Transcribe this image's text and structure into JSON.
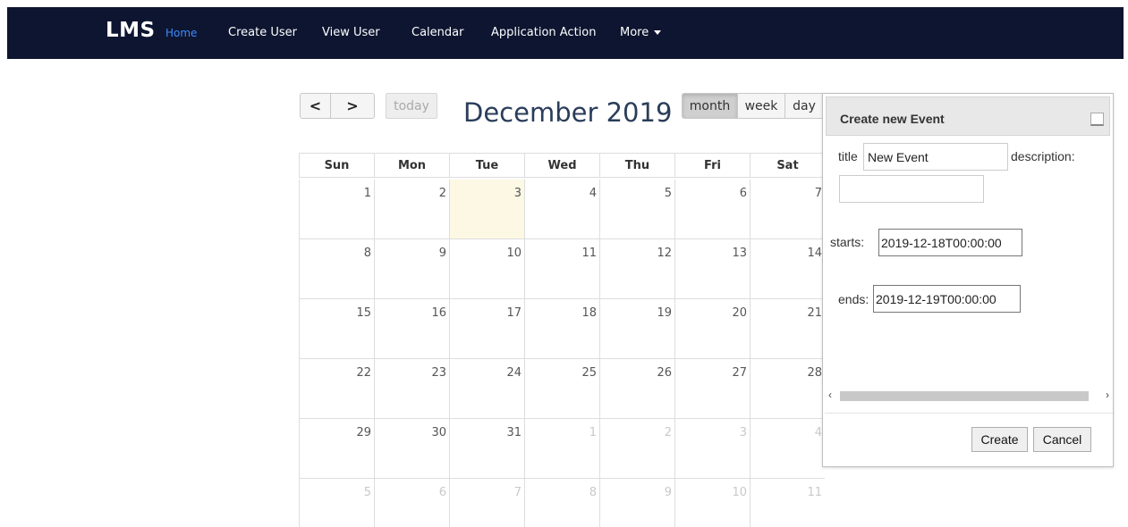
{
  "navbar": {
    "brand": "LMS",
    "items": [
      {
        "label": "Home"
      },
      {
        "label": "Create User"
      },
      {
        "label": "View User"
      },
      {
        "label": "Calendar"
      },
      {
        "label": "Application Action"
      },
      {
        "label": "More"
      }
    ]
  },
  "toolbar": {
    "prev_icon": "chevron-left-icon",
    "next_icon": "chevron-right-icon",
    "prev_glyph": "<",
    "next_glyph": ">",
    "today": "today",
    "title": "December 2019",
    "views": [
      {
        "label": "month",
        "active": true
      },
      {
        "label": "week",
        "active": false
      },
      {
        "label": "day",
        "active": false
      }
    ]
  },
  "calendar": {
    "weekdays": [
      "Sun",
      "Mon",
      "Tue",
      "Wed",
      "Thu",
      "Fri",
      "Sat"
    ],
    "weeks": [
      [
        "1",
        "2",
        "3",
        "4",
        "5",
        "6",
        "7"
      ],
      [
        "8",
        "9",
        "10",
        "11",
        "12",
        "13",
        "14"
      ],
      [
        "15",
        "16",
        "17",
        "18",
        "19",
        "20",
        "21"
      ],
      [
        "22",
        "23",
        "24",
        "25",
        "26",
        "27",
        "28"
      ],
      [
        "29",
        "30",
        "31",
        "1",
        "2",
        "3",
        "4"
      ],
      [
        "5",
        "6",
        "7",
        "8",
        "9",
        "10",
        "11"
      ]
    ],
    "today_index": [
      0,
      2
    ],
    "today_color": "#fcf8e3"
  },
  "dialog": {
    "title": "Create new Event",
    "title_label": "title",
    "title_value": "New Event",
    "description_label": "description:",
    "description_value": "",
    "starts_label": "starts:",
    "starts_value": "2019-12-18T00:00:00",
    "ends_label": "ends:",
    "ends_value": "2019-12-19T00:00:00",
    "create": "Create",
    "cancel": "Cancel"
  },
  "colors": {
    "navbar_bg": "#0d1530",
    "nav_active": "#3d8bfd",
    "title_color": "#2a3d5a"
  }
}
